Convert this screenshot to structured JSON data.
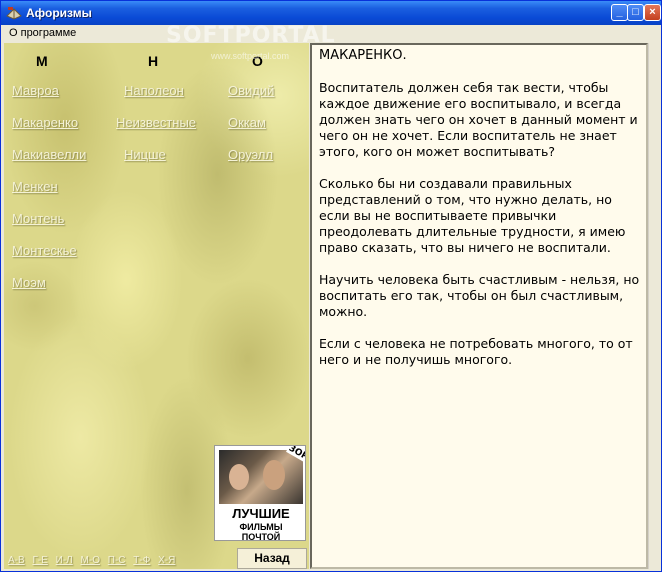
{
  "window": {
    "title": "Афоризмы"
  },
  "menu": {
    "about": "О программе"
  },
  "watermark": {
    "logo": "SOFTPORTAL",
    "url": "www.softportal.com"
  },
  "columns": [
    {
      "letter": "М",
      "authors": [
        "Моэм"
      ]
    },
    {
      "letter": "Н",
      "authors": [
        "Наполеон",
        "Неизвестные",
        "Ницше"
      ]
    },
    {
      "letter": "О",
      "authors": [
        "Овидий",
        "Оккам",
        "Оруэлл"
      ]
    }
  ],
  "authors_m": [
    "Мавроа",
    "Макаренко",
    "Макиавелли",
    "Менкен",
    "Монтень",
    "Монтескье",
    "Моэм"
  ],
  "alpha_nav": [
    "А-В",
    "Г-Е",
    "И-Л",
    "М-О",
    "П-С",
    "Т-Ф",
    "Х-Я"
  ],
  "ad": {
    "badge": "3ОР",
    "line1": "ЛУЧШИЕ",
    "line2": "ФИЛЬМЫ",
    "line3": "ПОЧТОЙ"
  },
  "back_button": "Назад",
  "text": {
    "title": "МАКАРЕНКО.",
    "paragraphs": [
      "Воспитатель должен себя так вести, чтобы каждое движение его воспитывало, и всегда должен знать чего он хочет в данный момент и чего он не хочет. Если воспитатель не знает этого, кого он может воспитывать?",
      "Сколько бы ни создавали правильных представлений о том, что нужно делать, но если вы не воспитываете привычки преодолевать длительные трудности, я имею право сказать, что вы ничего не воспитали.",
      "Научить человека быть счастливым - нельзя, но воспитать его так, чтобы он был счастливым, можно.",
      "Если с человека не потребовать многого, то от него и не получишь многого."
    ]
  }
}
